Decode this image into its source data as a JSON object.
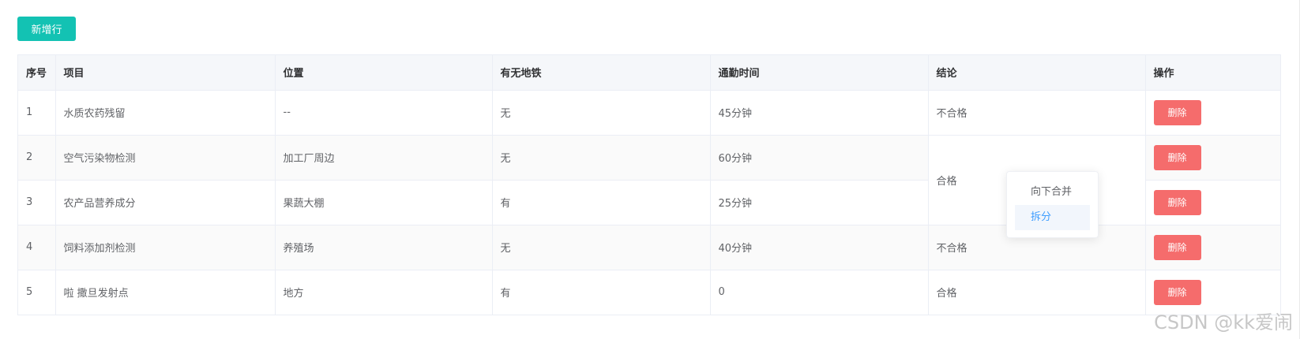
{
  "toolbar": {
    "add_row_label": "新增行"
  },
  "table": {
    "headers": [
      "序号",
      "项目",
      "位置",
      "有无地铁",
      "通勤时间",
      "结论",
      "操作"
    ],
    "rows": [
      {
        "index": "1",
        "item": "水质农药残留",
        "location": "--",
        "subway": "无",
        "commute": "45分钟",
        "conclusion": "不合格",
        "action": "删除"
      },
      {
        "index": "2",
        "item": "空气污染物检测",
        "location": "加工厂周边",
        "subway": "无",
        "commute": "60分钟",
        "conclusion": "合格",
        "action": "删除"
      },
      {
        "index": "3",
        "item": "农产品营养成分",
        "location": "果蔬大棚",
        "subway": "有",
        "commute": "25分钟",
        "conclusion": "",
        "action": "删除"
      },
      {
        "index": "4",
        "item": "饲料添加剂检测",
        "location": "养殖场",
        "subway": "无",
        "commute": "40分钟",
        "conclusion": "不合格",
        "action": "删除"
      },
      {
        "index": "5",
        "item": "啦 撒旦发射点",
        "location": "地方",
        "subway": "有",
        "commute": "0",
        "conclusion": "合格",
        "action": "删除"
      }
    ]
  },
  "context_menu": {
    "items": [
      {
        "label": "向下合并",
        "active": false
      },
      {
        "label": "拆分",
        "active": true
      }
    ]
  },
  "watermark": "CSDN @kk爱闹",
  "colors": {
    "primary": "#13c2b3",
    "danger": "#f56c6c",
    "header_bg": "#f5f7fa",
    "menu_active_text": "#409eff"
  }
}
